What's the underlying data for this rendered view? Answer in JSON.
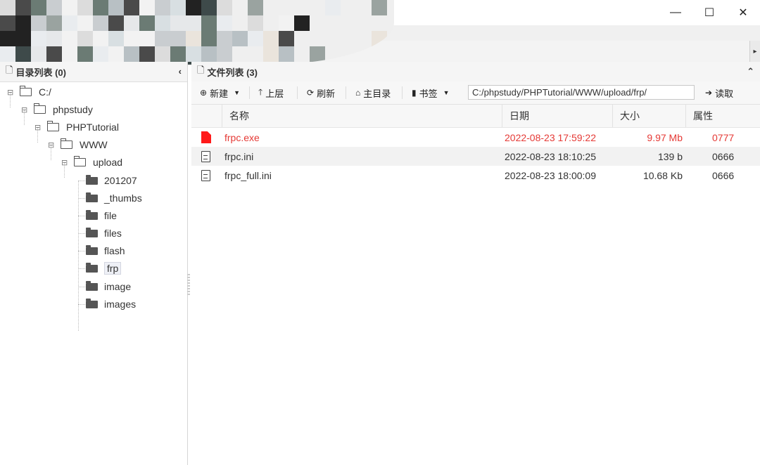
{
  "window": {
    "minimize": "—",
    "maximize": "☐",
    "close": "✕",
    "tab_scroll": "▸"
  },
  "left_panel": {
    "title": "目录列表 (0)",
    "collapse": "‹",
    "tree": [
      {
        "label": "C:/",
        "toggle": "⊟",
        "open": true
      },
      {
        "label": "phpstudy",
        "toggle": "⊟",
        "open": true
      },
      {
        "label": "PHPTutorial",
        "toggle": "⊟",
        "open": true
      },
      {
        "label": "WWW",
        "toggle": "⊟",
        "open": true
      },
      {
        "label": "upload",
        "toggle": "⊟",
        "open": true
      },
      {
        "label": "201207"
      },
      {
        "label": "_thumbs"
      },
      {
        "label": "file"
      },
      {
        "label": "files"
      },
      {
        "label": "flash"
      },
      {
        "label": "frp",
        "selected": true
      },
      {
        "label": "image"
      },
      {
        "label": "images"
      }
    ]
  },
  "right_panel": {
    "title": "文件列表 (3)",
    "collapse": "⌃",
    "toolbar": {
      "new": "新建",
      "up": "上层",
      "refresh": "刷新",
      "home": "主目录",
      "bookmark": "书签",
      "read": "读取",
      "path": "C:/phpstudy/PHPTutorial/WWW/upload/frp/"
    },
    "columns": {
      "name": "名称",
      "date": "日期",
      "size": "大小",
      "attr": "属性"
    },
    "files": [
      {
        "name": "frpc.exe",
        "date": "2022-08-23 17:59:22",
        "size": "9.97 Mb",
        "attr": "0777",
        "type": "exe"
      },
      {
        "name": "frpc.ini",
        "date": "2022-08-23 18:10:25",
        "size": "139 b",
        "attr": "0666",
        "type": "text"
      },
      {
        "name": "frpc_full.ini",
        "date": "2022-08-23 18:00:09",
        "size": "10.68 Kb",
        "attr": "0666",
        "type": "text"
      }
    ],
    "colors": {
      "highlight": "#e53935"
    }
  }
}
